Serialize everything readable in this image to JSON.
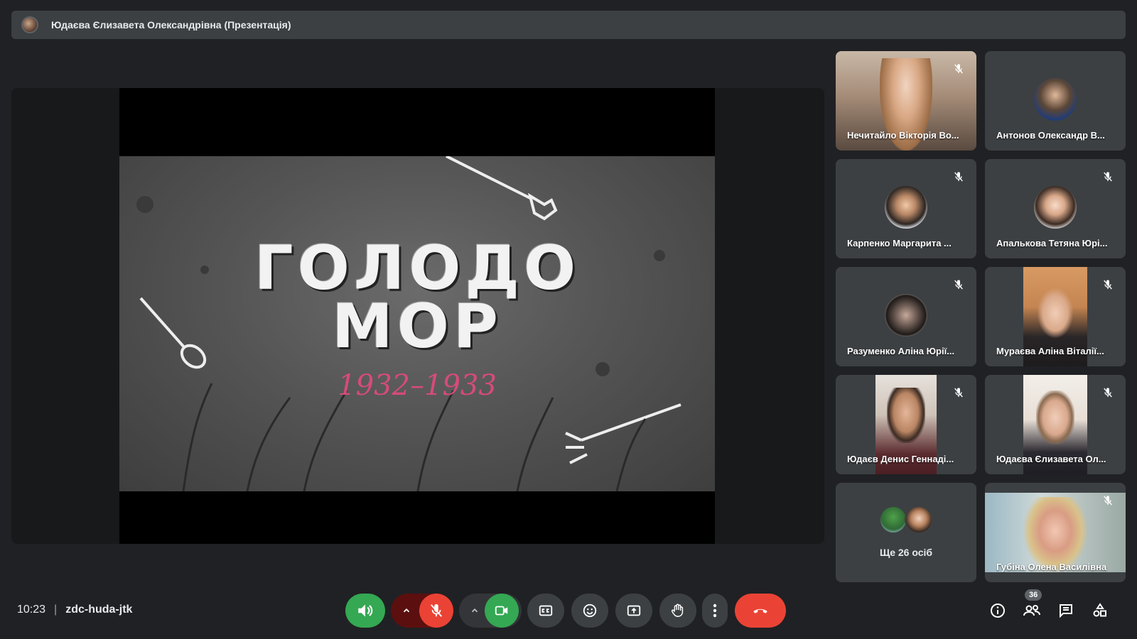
{
  "presenter": {
    "label": "Юдаєва Єлизавета Олександрівна (Презентація)"
  },
  "slide": {
    "title_line1": "ГОЛОДО",
    "title_line2": "МОР",
    "years": "1932–1933"
  },
  "participants": [
    {
      "name": "Нечитайло Вікторія Во...",
      "video": true,
      "muted": true
    },
    {
      "name": "Антонов Олександр В...",
      "video": false,
      "muted": false
    },
    {
      "name": "Карпенко Маргарита ...",
      "video": false,
      "muted": true
    },
    {
      "name": "Апалькова Тетяна Юрі...",
      "video": false,
      "muted": true
    },
    {
      "name": "Разуменко Аліна Юрії...",
      "video": false,
      "muted": true
    },
    {
      "name": "Мураєва Аліна Віталії...",
      "video": true,
      "muted": true
    },
    {
      "name": "Юдаєв Денис Геннаді...",
      "video": true,
      "muted": true
    },
    {
      "name": "Юдаєва Єлизавета Ол...",
      "video": true,
      "muted": true
    }
  ],
  "more_tile": {
    "label": "Ще 26 осіб"
  },
  "active_tile": {
    "name": "Губіна Олена Василівна",
    "muted": true
  },
  "meeting": {
    "time": "10:23",
    "separator": "|",
    "code": "zdc-huda-jtk"
  },
  "people_count": "36",
  "colors": {
    "background": "#202124",
    "tile": "#3c4043",
    "green": "#34a853",
    "red": "#ea4335",
    "accent_pink": "#d64b7a"
  },
  "icons": [
    "speaker-icon",
    "chevron-up-icon",
    "mic-off-icon",
    "camera-icon",
    "captions-icon",
    "emoji-icon",
    "present-icon",
    "hand-icon",
    "more-vert-icon",
    "hangup-icon",
    "info-icon",
    "people-icon",
    "chat-icon",
    "activities-icon"
  ]
}
